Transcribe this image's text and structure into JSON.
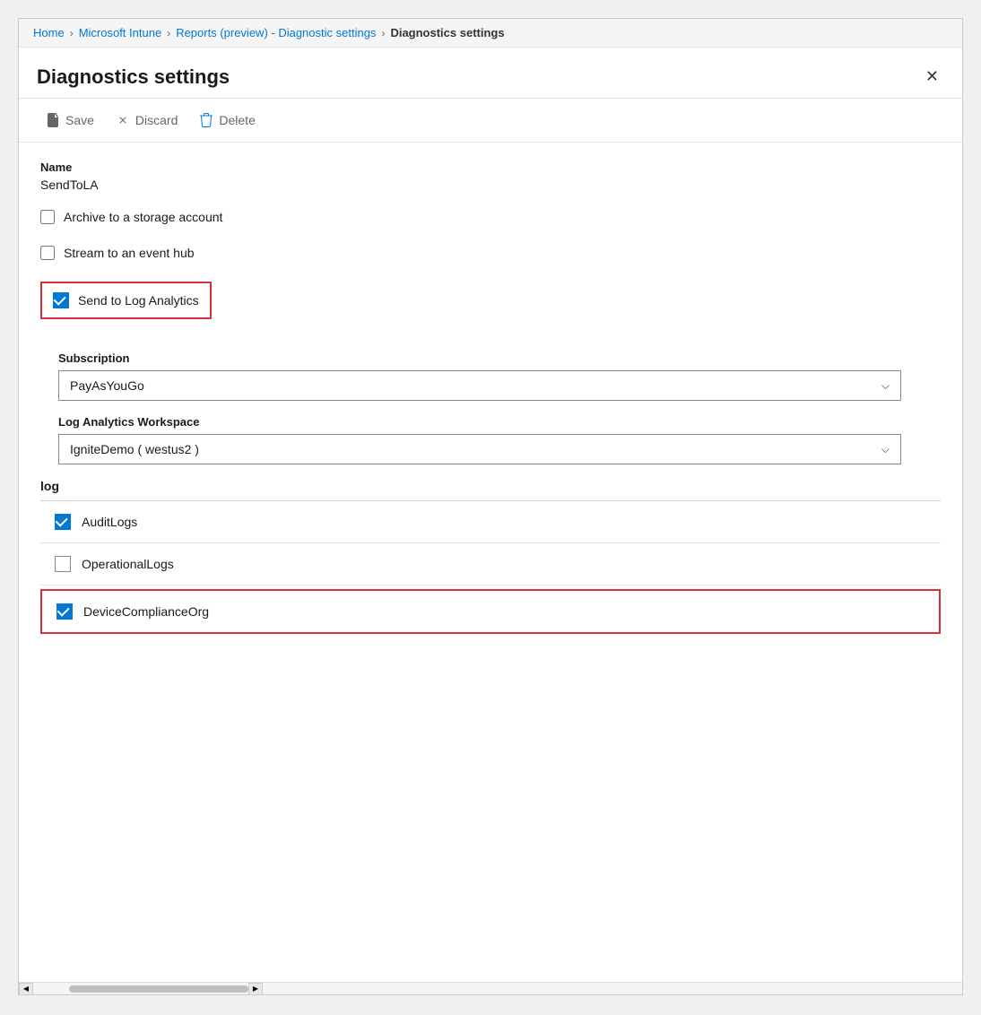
{
  "breadcrumb": {
    "items": [
      {
        "label": "Home",
        "link": true
      },
      {
        "label": "Microsoft Intune",
        "link": true
      },
      {
        "label": "Reports (preview) - Diagnostic settings",
        "link": true
      },
      {
        "label": "Diagnostics settings",
        "link": false
      }
    ]
  },
  "panel": {
    "title": "Diagnostics settings",
    "close_label": "✕"
  },
  "toolbar": {
    "save_label": "Save",
    "discard_label": "Discard",
    "delete_label": "Delete"
  },
  "form": {
    "name_label": "Name",
    "name_value": "SendToLA",
    "archive_label": "Archive to a storage account",
    "archive_checked": false,
    "stream_label": "Stream to an event hub",
    "stream_checked": false,
    "send_to_log_label": "Send to Log Analytics",
    "send_to_log_checked": true,
    "subscription_label": "Subscription",
    "subscription_value": "PayAsYouGo",
    "workspace_label": "Log Analytics Workspace",
    "workspace_value": "IgniteDemo ( westus2 )",
    "log_section_label": "log",
    "log_items": [
      {
        "label": "AuditLogs",
        "checked": true,
        "highlighted": false
      },
      {
        "label": "OperationalLogs",
        "checked": false,
        "highlighted": false
      },
      {
        "label": "DeviceComplianceOrg",
        "checked": true,
        "highlighted": true
      }
    ]
  }
}
